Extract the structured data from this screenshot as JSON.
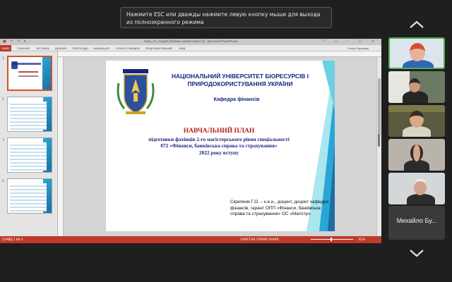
{
  "notice": {
    "text": "Нажмите ESC или дважды нажмите левую кнопку мыши для выхода из полноэкранного режима"
  },
  "ppt": {
    "window_title": "Навч_пл_magistr [Режим совместимости] - Microsoft PowerPoint",
    "ribbon_tabs": [
      "ФАЙЛ",
      "ГЛАВНАЯ",
      "ВСТАВКА",
      "ДИЗАЙН",
      "ПЕРЕХОДЫ",
      "АНИМАЦИЯ",
      "ПОКАЗ СЛАЙДОВ",
      "РЕЦЕНЗИРОВАНИЕ",
      "ВИД"
    ],
    "ribbon_right": "Ольга Скрипник",
    "thumb_numbers": [
      "1",
      "2",
      "3",
      "4"
    ],
    "active_slide": 1,
    "status_left": "СЛАЙД 1 ИЗ 4",
    "status_mid": "ЗАМЕТКИ    ПРИМЕЧАНИЯ",
    "zoom": "61%"
  },
  "slide": {
    "university": "НАЦІОНАЛЬНИЙ УНІВЕРСИТЕТ БІОРЕСУРСІВ І ПРИРОДОКОРИСТУВАННЯ УКРАЇНИ",
    "department": "Кафедра  фінансів",
    "title": "НАВЧАЛЬНИЙ ПЛАН",
    "subtitle_1": "підготовки фахівців 2-го магістерського рівня спеціальності",
    "subtitle_2": "072 «Фінанси, банківська справа та страхування»",
    "subtitle_3": "2022 року вступу",
    "author": "Скрипник Г.О. – к.е.н., доцент, доцент кафедри фінансів, гарант ОПП «Фінанси, банківська справа та страхування» ОС «Магістр»"
  },
  "call": {
    "participants": 5,
    "speaker_name": "Михайло Бу..."
  },
  "colors": {
    "accent_status": "#c0392b",
    "title_red": "#b71c1c",
    "title_blue": "#1a237e",
    "active_tile": "#4caf50"
  }
}
